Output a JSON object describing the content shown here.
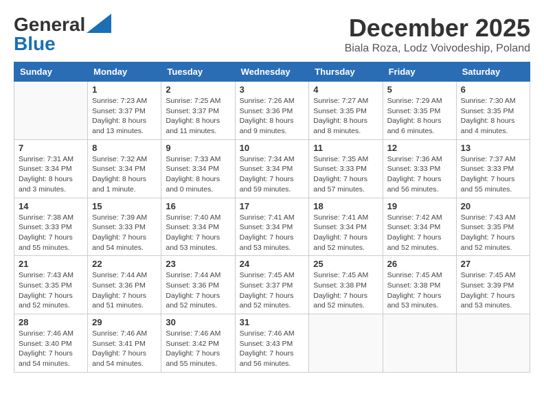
{
  "header": {
    "logo_general": "General",
    "logo_blue": "Blue",
    "month_title": "December 2025",
    "subtitle": "Biala Roza, Lodz Voivodeship, Poland"
  },
  "calendar": {
    "days_of_week": [
      "Sunday",
      "Monday",
      "Tuesday",
      "Wednesday",
      "Thursday",
      "Friday",
      "Saturday"
    ],
    "weeks": [
      [
        {
          "day": "",
          "info": ""
        },
        {
          "day": "1",
          "info": "Sunrise: 7:23 AM\nSunset: 3:37 PM\nDaylight: 8 hours\nand 13 minutes."
        },
        {
          "day": "2",
          "info": "Sunrise: 7:25 AM\nSunset: 3:37 PM\nDaylight: 8 hours\nand 11 minutes."
        },
        {
          "day": "3",
          "info": "Sunrise: 7:26 AM\nSunset: 3:36 PM\nDaylight: 8 hours\nand 9 minutes."
        },
        {
          "day": "4",
          "info": "Sunrise: 7:27 AM\nSunset: 3:35 PM\nDaylight: 8 hours\nand 8 minutes."
        },
        {
          "day": "5",
          "info": "Sunrise: 7:29 AM\nSunset: 3:35 PM\nDaylight: 8 hours\nand 6 minutes."
        },
        {
          "day": "6",
          "info": "Sunrise: 7:30 AM\nSunset: 3:35 PM\nDaylight: 8 hours\nand 4 minutes."
        }
      ],
      [
        {
          "day": "7",
          "info": "Sunrise: 7:31 AM\nSunset: 3:34 PM\nDaylight: 8 hours\nand 3 minutes."
        },
        {
          "day": "8",
          "info": "Sunrise: 7:32 AM\nSunset: 3:34 PM\nDaylight: 8 hours\nand 1 minute."
        },
        {
          "day": "9",
          "info": "Sunrise: 7:33 AM\nSunset: 3:34 PM\nDaylight: 8 hours\nand 0 minutes."
        },
        {
          "day": "10",
          "info": "Sunrise: 7:34 AM\nSunset: 3:34 PM\nDaylight: 7 hours\nand 59 minutes."
        },
        {
          "day": "11",
          "info": "Sunrise: 7:35 AM\nSunset: 3:33 PM\nDaylight: 7 hours\nand 57 minutes."
        },
        {
          "day": "12",
          "info": "Sunrise: 7:36 AM\nSunset: 3:33 PM\nDaylight: 7 hours\nand 56 minutes."
        },
        {
          "day": "13",
          "info": "Sunrise: 7:37 AM\nSunset: 3:33 PM\nDaylight: 7 hours\nand 55 minutes."
        }
      ],
      [
        {
          "day": "14",
          "info": "Sunrise: 7:38 AM\nSunset: 3:33 PM\nDaylight: 7 hours\nand 55 minutes."
        },
        {
          "day": "15",
          "info": "Sunrise: 7:39 AM\nSunset: 3:33 PM\nDaylight: 7 hours\nand 54 minutes."
        },
        {
          "day": "16",
          "info": "Sunrise: 7:40 AM\nSunset: 3:34 PM\nDaylight: 7 hours\nand 53 minutes."
        },
        {
          "day": "17",
          "info": "Sunrise: 7:41 AM\nSunset: 3:34 PM\nDaylight: 7 hours\nand 53 minutes."
        },
        {
          "day": "18",
          "info": "Sunrise: 7:41 AM\nSunset: 3:34 PM\nDaylight: 7 hours\nand 52 minutes."
        },
        {
          "day": "19",
          "info": "Sunrise: 7:42 AM\nSunset: 3:34 PM\nDaylight: 7 hours\nand 52 minutes."
        },
        {
          "day": "20",
          "info": "Sunrise: 7:43 AM\nSunset: 3:35 PM\nDaylight: 7 hours\nand 52 minutes."
        }
      ],
      [
        {
          "day": "21",
          "info": "Sunrise: 7:43 AM\nSunset: 3:35 PM\nDaylight: 7 hours\nand 52 minutes."
        },
        {
          "day": "22",
          "info": "Sunrise: 7:44 AM\nSunset: 3:36 PM\nDaylight: 7 hours\nand 51 minutes."
        },
        {
          "day": "23",
          "info": "Sunrise: 7:44 AM\nSunset: 3:36 PM\nDaylight: 7 hours\nand 52 minutes."
        },
        {
          "day": "24",
          "info": "Sunrise: 7:45 AM\nSunset: 3:37 PM\nDaylight: 7 hours\nand 52 minutes."
        },
        {
          "day": "25",
          "info": "Sunrise: 7:45 AM\nSunset: 3:38 PM\nDaylight: 7 hours\nand 52 minutes."
        },
        {
          "day": "26",
          "info": "Sunrise: 7:45 AM\nSunset: 3:38 PM\nDaylight: 7 hours\nand 53 minutes."
        },
        {
          "day": "27",
          "info": "Sunrise: 7:45 AM\nSunset: 3:39 PM\nDaylight: 7 hours\nand 53 minutes."
        }
      ],
      [
        {
          "day": "28",
          "info": "Sunrise: 7:46 AM\nSunset: 3:40 PM\nDaylight: 7 hours\nand 54 minutes."
        },
        {
          "day": "29",
          "info": "Sunrise: 7:46 AM\nSunset: 3:41 PM\nDaylight: 7 hours\nand 54 minutes."
        },
        {
          "day": "30",
          "info": "Sunrise: 7:46 AM\nSunset: 3:42 PM\nDaylight: 7 hours\nand 55 minutes."
        },
        {
          "day": "31",
          "info": "Sunrise: 7:46 AM\nSunset: 3:43 PM\nDaylight: 7 hours\nand 56 minutes."
        },
        {
          "day": "",
          "info": ""
        },
        {
          "day": "",
          "info": ""
        },
        {
          "day": "",
          "info": ""
        }
      ]
    ]
  }
}
